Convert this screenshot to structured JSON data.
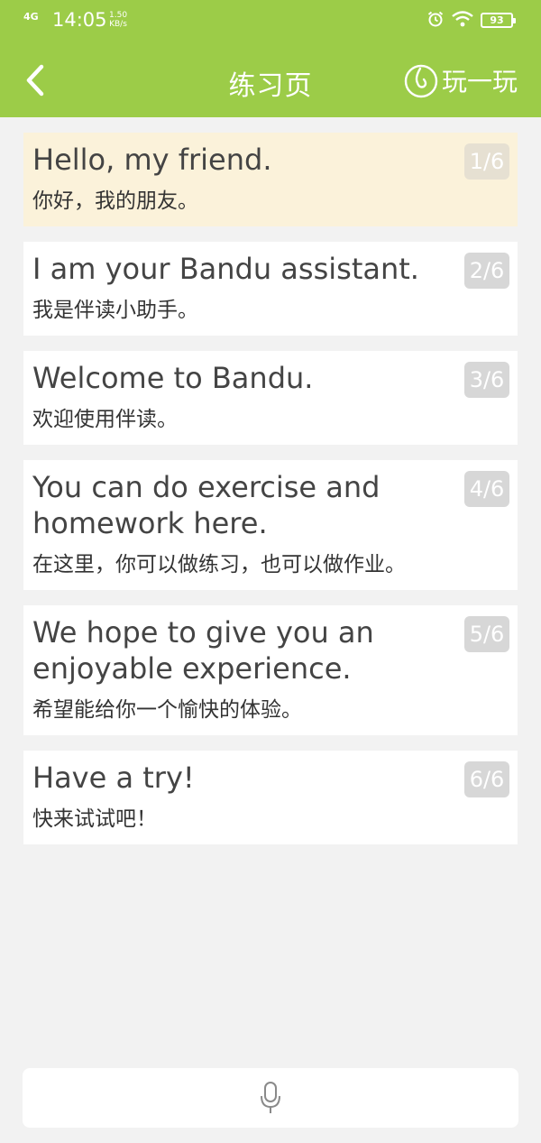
{
  "status_bar": {
    "network": "4G",
    "time": "14:05",
    "speed_value": "1.50",
    "speed_unit": "KB/s",
    "battery": "93"
  },
  "nav": {
    "title": "练习页",
    "play_label": "玩一玩"
  },
  "sentences": [
    {
      "en": "Hello, my friend.",
      "zh": "你好，我的朋友。",
      "index": "1/6",
      "active": true
    },
    {
      "en": "I am your Bandu assistant.",
      "zh": "我是伴读小助手。",
      "index": "2/6",
      "active": false
    },
    {
      "en": "Welcome to Bandu.",
      "zh": "欢迎使用伴读。",
      "index": "3/6",
      "active": false
    },
    {
      "en": "You can do exercise and homework here.",
      "zh": "在这里，你可以做练习，也可以做作业。",
      "index": "4/6",
      "active": false
    },
    {
      "en": "We hope to give you an enjoyable experience.",
      "zh": "希望能给你一个愉快的体验。",
      "index": "5/6",
      "active": false
    },
    {
      "en": "Have a try!",
      "zh": "快来试试吧！",
      "index": "6/6",
      "active": false
    }
  ],
  "colors": {
    "header": "#9ccc48",
    "active_card": "#fbf2da",
    "badge": "#d7d7d7"
  },
  "icons": {
    "back": "chevron-left-icon",
    "play": "game-icon",
    "mic": "microphone-icon",
    "alarm": "alarm-icon",
    "wifi": "wifi-icon"
  }
}
